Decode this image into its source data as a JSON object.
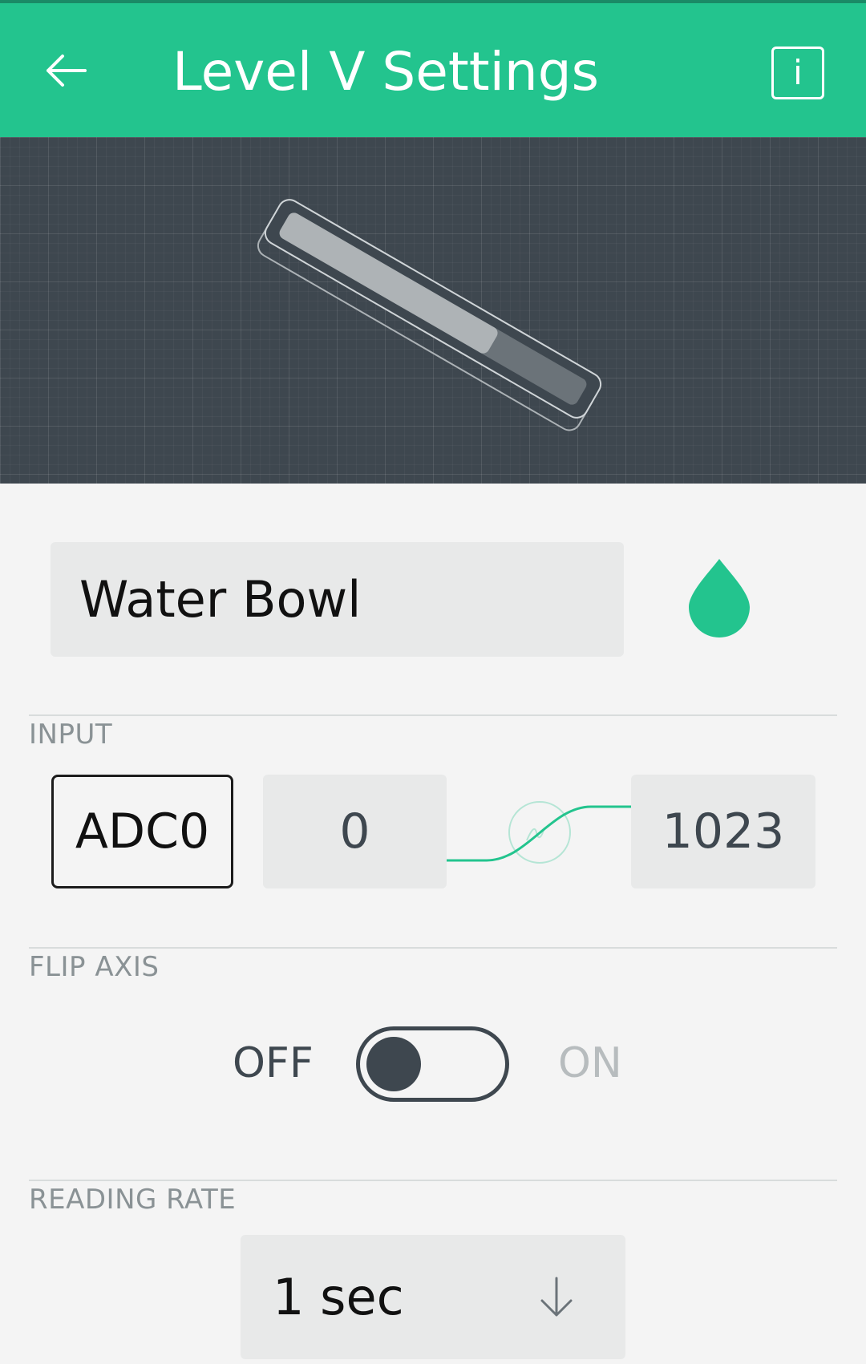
{
  "header": {
    "title": "Level V Settings",
    "back_icon": "arrow-left-icon",
    "info_icon": "info-icon",
    "info_label": "i",
    "background_color": "#23c48e"
  },
  "preview": {
    "widget": "vertical-level-widget",
    "fill_level": 0.7,
    "background_color": "#3e474f"
  },
  "widget_name": {
    "value": "Water Bowl"
  },
  "color_picker": {
    "icon": "water-drop-icon",
    "color": "#23c48e"
  },
  "input": {
    "label": "INPUT",
    "pin": "ADC0",
    "min": "0",
    "max": "1023"
  },
  "flip_axis": {
    "label": "FLIP AXIS",
    "off_label": "OFF",
    "on_label": "ON",
    "enabled": false
  },
  "reading_rate": {
    "label": "READING RATE",
    "value": "1 sec",
    "dropdown_icon": "arrow-down-icon"
  }
}
